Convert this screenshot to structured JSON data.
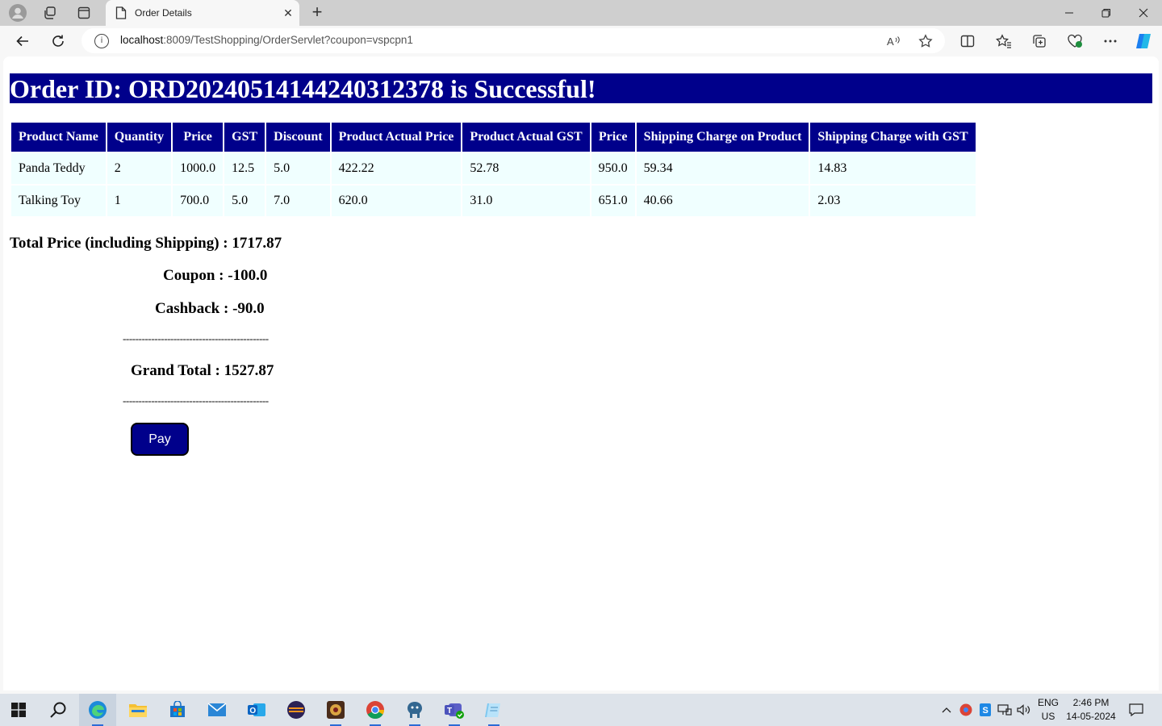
{
  "browser": {
    "tab_title": "Order Details",
    "url_host": "localhost",
    "url_rest": ":8009/TestShopping/OrderServlet?coupon=vspcpn1"
  },
  "page": {
    "heading": "Order ID: ORD20240514144240312378 is Successful!",
    "table": {
      "headers": [
        "Product Name",
        "Quantity",
        "Price",
        "GST",
        "Discount",
        "Product Actual Price",
        "Product Actual GST",
        "Price",
        "Shipping Charge on Product",
        "Shipping Charge with GST"
      ],
      "rows": [
        [
          "Panda Teddy",
          "2",
          "1000.0",
          "12.5",
          "5.0",
          "422.22",
          "52.78",
          "950.0",
          "59.34",
          "14.83"
        ],
        [
          "Talking Toy",
          "1",
          "700.0",
          "5.0",
          "7.0",
          "620.0",
          "31.0",
          "651.0",
          "40.66",
          "2.03"
        ]
      ]
    },
    "total_price": "Total Price (including Shipping) : 1717.87",
    "coupon": "Coupon : -100.0",
    "cashback": "Cashback : -90.0",
    "separator": "----------------------------------------------",
    "grand_total": "Grand Total : 1527.87",
    "pay_label": "Pay"
  },
  "taskbar": {
    "lang_line1": "ENG",
    "lang_line2": "US",
    "time": "2:46 PM",
    "date": "14-05-2024"
  },
  "colors": {
    "heading_bg": "#00008b",
    "cell_bg": "#f0ffff",
    "accent": "#2c6bd6"
  }
}
